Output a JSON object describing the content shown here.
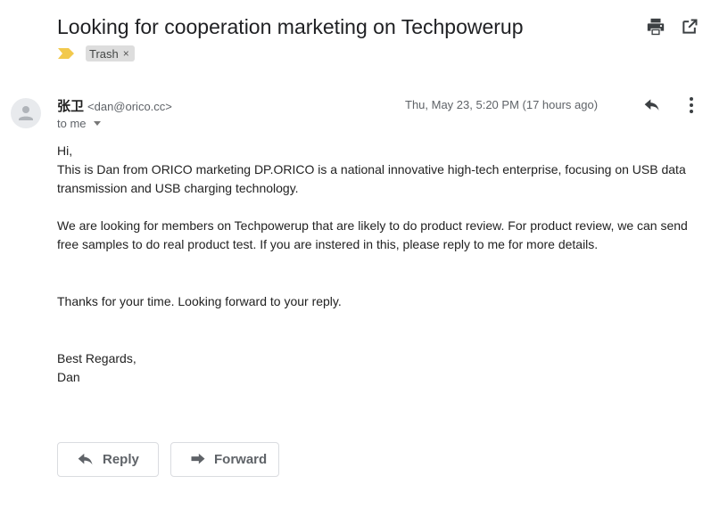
{
  "email": {
    "subject": "Looking for cooperation marketing on Techpowerup",
    "labels": [
      {
        "name": "Trash",
        "remove_glyph": "×"
      }
    ],
    "importance_marker_color": "#f2c94c",
    "sender": {
      "name": "张卫",
      "email": "<dan@orico.cc>"
    },
    "recipient_text": "to me",
    "timestamp": "Thu, May 23, 5:20 PM (17 hours ago)",
    "body": {
      "greeting": "Hi,",
      "line1": "This is Dan from ORICO marketing DP.ORICO is a national innovative high-tech enterprise, focusing on USB data transmission and USB charging technology.",
      "line2": "We are looking for members on Techpowerup that are likely to do product review. For product review, we can send free samples to do real product test. If you are instered in this, please reply to me for more details.",
      "line3": "Thanks for your time. Looking forward to your reply.",
      "closing": "Best Regards,",
      "signature": "Dan"
    }
  },
  "toolbar": {
    "print_icon": "printer-icon",
    "open_new_window_icon": "open-in-new-icon"
  },
  "message_actions": {
    "reply_icon": "reply-arrow-icon",
    "more_icon": "more-vertical-icon"
  },
  "buttons": {
    "reply_label": "Reply",
    "forward_label": "Forward"
  },
  "colors": {
    "icon_dark": "#3c4043",
    "icon_grey": "#5f6368",
    "chip_bg": "#dddddd"
  }
}
